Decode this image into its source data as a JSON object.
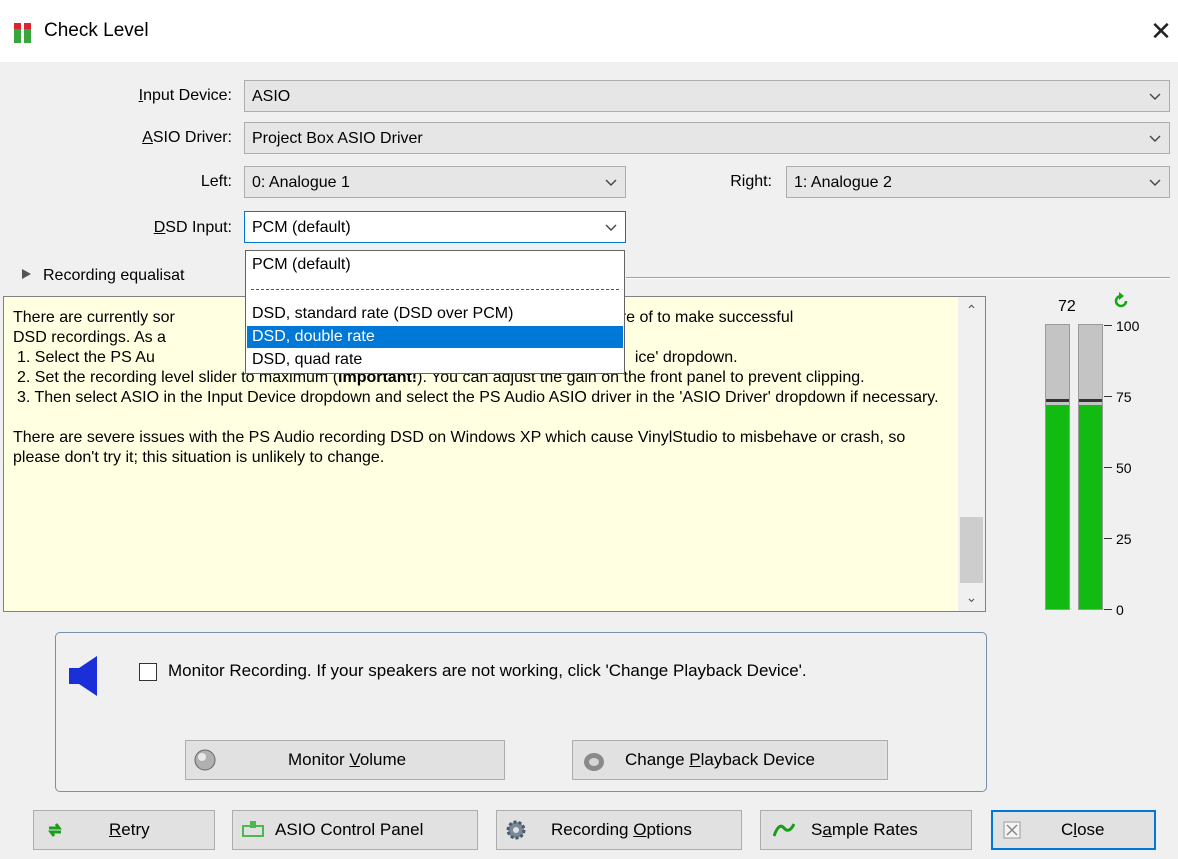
{
  "window": {
    "title": "Check Level",
    "close_glyph": "✕"
  },
  "form": {
    "input_device": {
      "label_pre": "",
      "label_u": "I",
      "label_post": "nput Device:",
      "value": "ASIO"
    },
    "asio_driver": {
      "label_pre": "",
      "label_u": "A",
      "label_post": "SIO Driver:",
      "value": "Project Box ASIO Driver"
    },
    "left": {
      "label": "Left:",
      "value": "0: Analogue 1"
    },
    "right": {
      "label": "Right:",
      "value": "1: Analogue 2"
    },
    "dsd_input": {
      "label_pre": "",
      "label_u": "D",
      "label_post": "SD Input:",
      "value": "PCM (default)"
    }
  },
  "dsd_dropdown": {
    "options": [
      "PCM (default)",
      "DSD, standard rate (DSD over PCM)",
      "DSD, double rate",
      "DSD, quad rate"
    ],
    "selected_index": 2
  },
  "equalisation": {
    "label": "Recording equalisat"
  },
  "notes": {
    "p1": "There are currently sor",
    "p1b": "o be aware of to make successful",
    "p1c": "DSD recordings.  As a",
    "item1a": "1.  Select the PS Au",
    "item1b": "ice' dropdown.",
    "item2a": "2.  Set the recording level slider to maximum (",
    "item2bold": "important!",
    "item2b": ").  You can adjust the gain on the front panel to prevent clipping.",
    "item3": "3.  Then select ASIO in the Input Device dropdown and select the PS Audio ASIO driver in the 'ASIO Driver' dropdown if necessary.",
    "p2": "There are severe issues with the PS Audio recording DSD on Windows XP which cause VinylStudio to misbehave or crash, so please don't try it; this situation is unlikely to change."
  },
  "meter": {
    "value": "72",
    "level_fraction": 0.72,
    "peak_fraction": 0.73,
    "scale": [
      "100",
      "75",
      "50",
      "25",
      "0"
    ],
    "colors": {
      "level": "#11bb11",
      "background": "#c4c4c4"
    }
  },
  "monitor": {
    "checkbox_checked": false,
    "text": "Monitor Recording.  If your speakers are not working, click 'Change Playback Device'.",
    "volume_button": {
      "pre": "Monitor ",
      "u": "V",
      "post": "olume"
    },
    "playback_button": {
      "pre": "Change ",
      "u": "P",
      "post": "layback Device"
    }
  },
  "buttons": {
    "retry": {
      "pre": "",
      "u": "R",
      "post": "etry"
    },
    "asio_panel": {
      "pre": "ASIO Control Panel",
      "u": "",
      "post": ""
    },
    "recording_options": {
      "pre": "Recording ",
      "u": "O",
      "post": "ptions"
    },
    "sample_rates": {
      "pre": "S",
      "u": "a",
      "post": "mple Rates"
    },
    "close": {
      "pre": "C",
      "u": "l",
      "post": "ose"
    }
  },
  "colors": {
    "accent": "#0078d7",
    "notes_bg": "#ffffe1",
    "speaker": "#1a2fd8"
  }
}
